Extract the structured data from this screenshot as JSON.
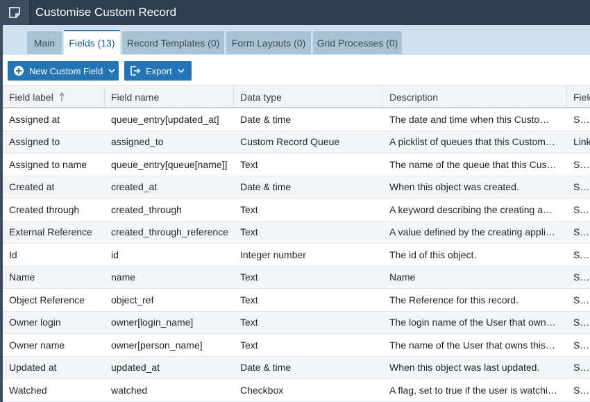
{
  "window": {
    "title": "Customise Custom Record",
    "icon": "note-icon"
  },
  "tabs": [
    {
      "label": "Main",
      "active": false
    },
    {
      "label": "Fields (13)",
      "active": true
    },
    {
      "label": "Record Templates (0)",
      "active": false
    },
    {
      "label": "Form Layouts (0)",
      "active": false
    },
    {
      "label": "Grid Processes (0)",
      "active": false
    }
  ],
  "toolbar": {
    "new_field_label": "New Custom Field",
    "export_label": "Export"
  },
  "table": {
    "columns": [
      "Field label",
      "Field name",
      "Data type",
      "Description",
      "Field"
    ],
    "sorted_column": "Field label",
    "rows": [
      [
        "Assigned at",
        "queue_entry[updated_at]",
        "Date & time",
        "The date and time when this Custom Record was assigned",
        "Standard"
      ],
      [
        "Assigned to",
        "assigned_to",
        "Custom Record Queue",
        "A picklist of queues that this Custom Record can be assigned to",
        "Link"
      ],
      [
        "Assigned to name",
        "queue_entry[queue[name]]",
        "Text",
        "The name of the queue that this Custom Record is assigned to",
        "Standard"
      ],
      [
        "Created at",
        "created_at",
        "Date & time",
        "When this object was created.",
        "Standard"
      ],
      [
        "Created through",
        "created_through",
        "Text",
        "A keyword describing the creating application",
        "Standard"
      ],
      [
        "External Reference",
        "created_through_reference",
        "Text",
        "A value defined by the creating application",
        "Standard"
      ],
      [
        "Id",
        "id",
        "Integer number",
        "The id of this object.",
        "Standard"
      ],
      [
        "Name",
        "name",
        "Text",
        "Name",
        "Standard"
      ],
      [
        "Object Reference",
        "object_ref",
        "Text",
        "The Reference for this record.",
        "Standard"
      ],
      [
        "Owner login",
        "owner[login_name]",
        "Text",
        "The login name of the User that owns this record",
        "Standard"
      ],
      [
        "Owner name",
        "owner[person_name]",
        "Text",
        "The name of the User that owns this object",
        "Standard"
      ],
      [
        "Updated at",
        "updated_at",
        "Date & time",
        "When this object was last updated.",
        "Standard"
      ],
      [
        "Watched",
        "watched",
        "Checkbox",
        "A flag, set to true if the user is watching this record",
        "Standard"
      ]
    ]
  },
  "colors": {
    "titlebar": "#2d3e50",
    "tabbar": "#cfe1ee",
    "tab": "#a9c3d6",
    "button": "#2475b5"
  }
}
